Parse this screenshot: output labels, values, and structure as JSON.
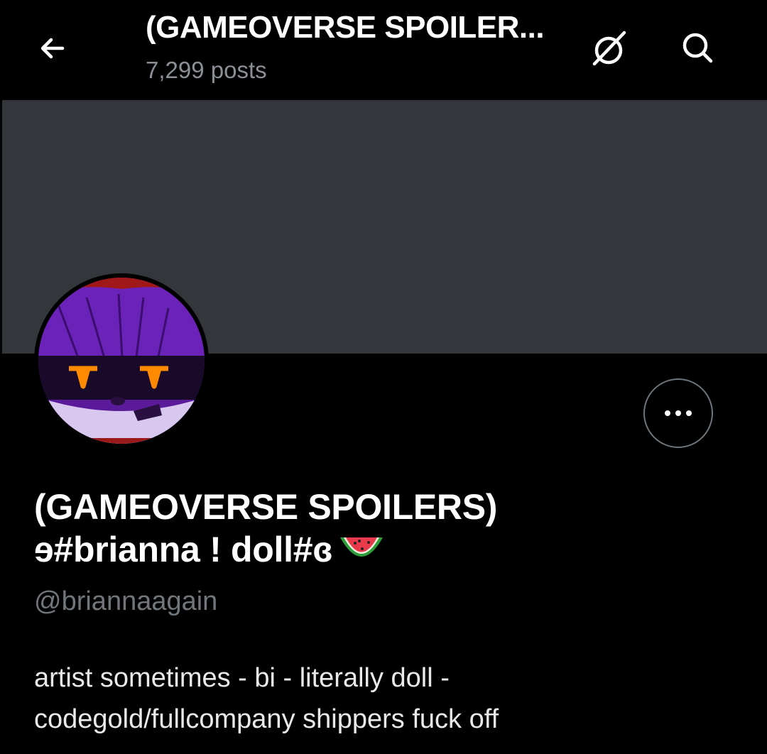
{
  "header": {
    "title": "(GAMEOVERSE SPOILER...",
    "posts": "7,299 posts",
    "back_icon": "arrow-left-icon",
    "grok_icon": "grok-icon",
    "search_icon": "search-icon"
  },
  "profile": {
    "display_name_line1": "(GAMEOVERSE SPOILERS)",
    "display_name_line2": "ɘ#brianna ! doll#ɞ",
    "handle": "@briannaagain",
    "bio_line1": "artist sometimes - bi - literally doll -",
    "bio_line2": "codegold/fullcompany shippers fuck off",
    "more_icon": "more-dots-icon",
    "emoji_icon": "watermelon-icon"
  },
  "colors": {
    "background": "#000000",
    "banner": "#33363a",
    "text_primary": "#e7e9ea",
    "text_secondary": "#71767b",
    "border": "#6e767d"
  }
}
